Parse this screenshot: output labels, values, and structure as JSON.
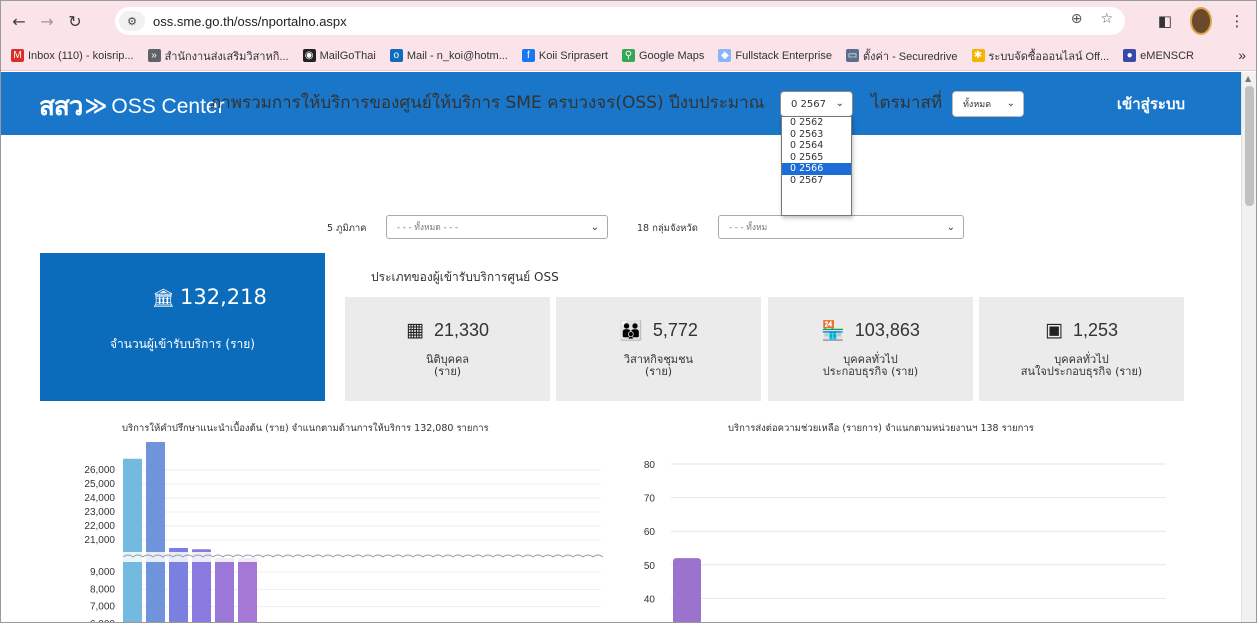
{
  "browser": {
    "url": "oss.sme.go.th/oss/nportalno.aspx",
    "bookmarks": [
      {
        "label": "Inbox (110) - koisrip...",
        "color": "#d93025",
        "icon": "M"
      },
      {
        "label": "สำนักงานส่งเสริมวิสาหกิ...",
        "color": "#5f6368",
        "icon": "»"
      },
      {
        "label": "MailGoThai",
        "color": "#202124",
        "icon": "◉"
      },
      {
        "label": "Mail - n_koi@hotm...",
        "color": "#0f6cbd",
        "icon": "o"
      },
      {
        "label": "Koii Sriprasert",
        "color": "#1877f2",
        "icon": "f"
      },
      {
        "label": "Google Maps",
        "color": "#34a853",
        "icon": "⚲"
      },
      {
        "label": "Fullstack Enterprise",
        "color": "#8ab4f8",
        "icon": "◆"
      },
      {
        "label": "ตั้งค่า - Securedrive",
        "color": "#5a6f8e",
        "icon": "▭"
      },
      {
        "label": "ระบบจัดซื้อออนไลน์ Off...",
        "color": "#f4b400",
        "icon": "✱"
      },
      {
        "label": "eMENSCR",
        "color": "#3949ab",
        "icon": "●"
      }
    ]
  },
  "header": {
    "logo_thai": "สสว",
    "logo_chevron": "≫",
    "logo_text": "OSS Center",
    "login": "เข้าสู่ระบบ"
  },
  "heading": {
    "title": "ภาพรวมการให้บริการของศูนย์ให้บริการ SME ครบวงจร(OSS) ปีงบประมาณ",
    "year_selected": "0 2567",
    "quarter_label": "ไตรมาสที่",
    "quarter_selected": "ทั้งหมด"
  },
  "year_options": [
    "0 2562",
    "0 2563",
    "0 2564",
    "0 2565",
    "0 2566",
    "0 2567"
  ],
  "year_highlighted": "0 2566",
  "filters": {
    "region_label": "5 ภูมิภาค",
    "region_value": "- - - ทั้งหมด - - -",
    "province_label": "18 กลุ่มจังหวัด",
    "province_value": "- - - ทั้งหม"
  },
  "total": {
    "value": "132,218",
    "label": "จำนวนผู้เข้ารับบริการ (ราย)"
  },
  "types_title": "ประเภทของผู้เข้ารับบริการศูนย์ OSS",
  "types": [
    {
      "value": "21,330",
      "label1": "นิติบุคคล",
      "label2": "(ราย)",
      "icon": "building-icon"
    },
    {
      "value": "5,772",
      "label1": "วิสาหกิจชุมชน",
      "label2": "(ราย)",
      "icon": "group-icon"
    },
    {
      "value": "103,863",
      "label1": "บุคคลทั่วไป",
      "label2": "ประกอบธุรกิจ (ราย)",
      "icon": "shop-icon"
    },
    {
      "value": "1,253",
      "label1": "บุคคลทั่วไป",
      "label2": "สนใจประกอบธุรกิจ (ราย)",
      "icon": "id-card-icon"
    }
  ],
  "charts_titles": {
    "left": "บริการให้คำปรึกษาแนะนำเบื้องต้น (ราย) จำแนกตามด้านการให้บริการ 132,080 รายการ",
    "right": "บริการส่งต่อความช่วยเหลือ (รายการ) จำแนกตามหน่วยงานฯ 138 รายการ"
  },
  "colors": {
    "header": "#1976c9",
    "total_box": "#0b6cbc",
    "card": "#ebebeb"
  },
  "chart_data": [
    {
      "type": "bar",
      "title": "บริการให้คำปรึกษาแนะนำเบื้องต้น (ราย) จำแนกตามด้านการให้บริการ 132,080 รายการ",
      "broken_axis": true,
      "y_ticks_upper": [
        "26,000",
        "25,000",
        "24,000",
        "23,000",
        "22,000",
        "21,000"
      ],
      "y_ticks_lower": [
        "9,000",
        "8,000",
        "7,000",
        "6,000"
      ],
      "bars": [
        {
          "value": 26800,
          "color": "#74b9e0"
        },
        {
          "value": 20800,
          "color": "#6f94dc"
        },
        {
          "value": 10100,
          "color": "#7b7fe0"
        },
        {
          "value": 10000,
          "color": "#8a79de"
        },
        {
          "value": 9650,
          "color": "#9b78d8"
        },
        {
          "value": 9600,
          "color": "#a578d6"
        }
      ]
    },
    {
      "type": "bar",
      "title": "บริการส่งต่อความช่วยเหลือ (รายการ) จำแนกตามหน่วยงานฯ 138 รายการ",
      "y_ticks": [
        "80",
        "70",
        "60",
        "50",
        "40",
        "30"
      ],
      "ylim": [
        30,
        80
      ],
      "bars": [
        {
          "value": 52,
          "color": "#9b73cf"
        }
      ]
    }
  ]
}
